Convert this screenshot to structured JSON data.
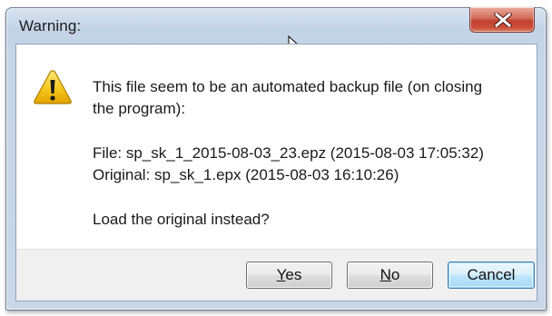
{
  "window": {
    "title": "Warning:"
  },
  "message": {
    "line1": "This file seem to be an automated backup file (on closing",
    "line2": "the program):",
    "file_line": "File: sp_sk_1_2015-08-03_23.epz (2015-08-03 17:05:32)",
    "original_line": "Original: sp_sk_1.epx (2015-08-03 16:10:26)",
    "question": "Load the original instead?"
  },
  "buttons": {
    "yes": {
      "mnemonic": "Y",
      "rest": "es"
    },
    "no": {
      "mnemonic": "N",
      "rest": "o"
    },
    "cancel": "Cancel"
  },
  "icons": {
    "close": "close-icon",
    "warning": "warning-icon",
    "cursor": "mouse-pointer-icon"
  },
  "colors": {
    "close_button": "#c94c37",
    "warning_yellow": "#f5c518",
    "default_button_border": "#3c7fb1",
    "title_bar": "#c3d3e6"
  }
}
